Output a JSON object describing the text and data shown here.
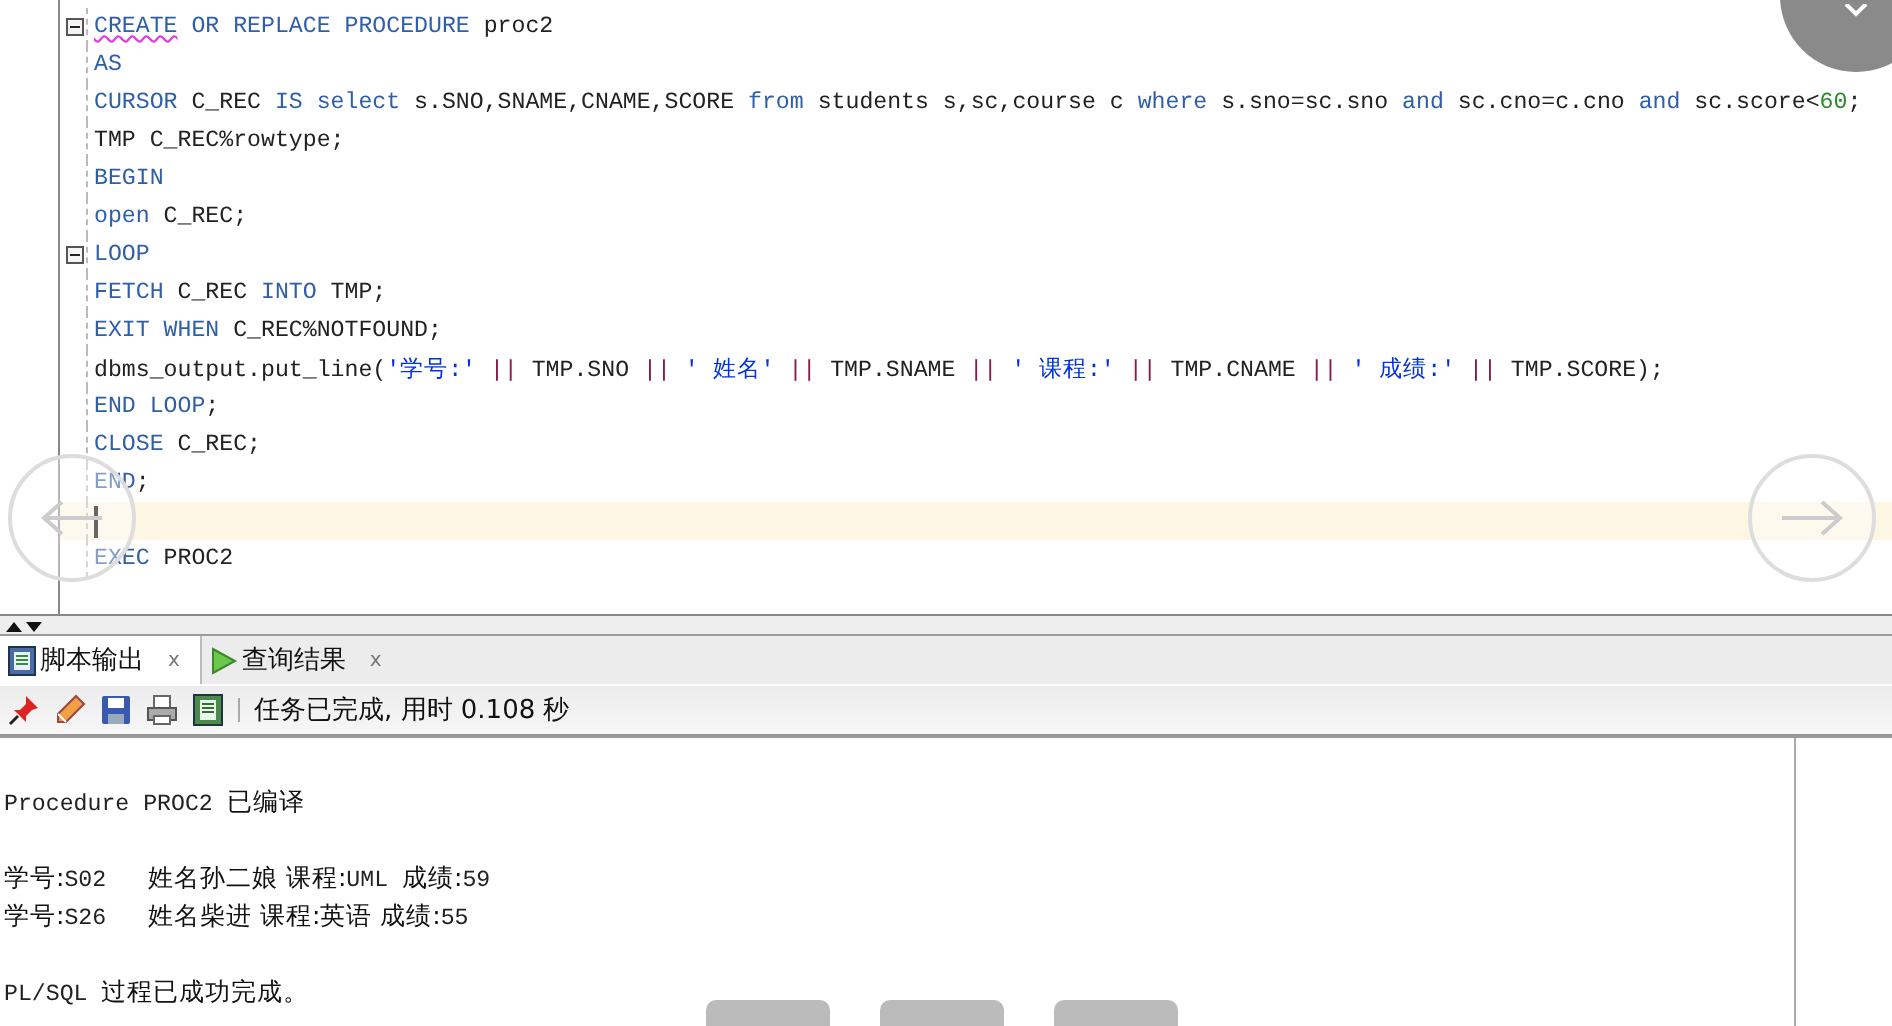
{
  "editor": {
    "lines": [
      {
        "fold": true,
        "current": false,
        "tokens": [
          {
            "kind": "kw",
            "text": "CREATE",
            "squiggle": true
          },
          {
            "kind": "kw",
            "text": " OR REPLACE PROCEDURE"
          },
          {
            "kind": "id",
            "text": " proc2"
          }
        ]
      },
      {
        "fold": false,
        "current": false,
        "tokens": [
          {
            "kind": "kw",
            "text": "AS"
          }
        ]
      },
      {
        "fold": false,
        "current": false,
        "tokens": [
          {
            "kind": "kw",
            "text": "CURSOR"
          },
          {
            "kind": "id",
            "text": " C_REC "
          },
          {
            "kind": "kw",
            "text": "IS select"
          },
          {
            "kind": "id",
            "text": " s.SNO,SNAME,CNAME,SCORE "
          },
          {
            "kind": "kw",
            "text": "from"
          },
          {
            "kind": "id",
            "text": " students s,sc,course c "
          },
          {
            "kind": "kw",
            "text": "where"
          },
          {
            "kind": "id",
            "text": " s.sno=sc.sno "
          },
          {
            "kind": "kw",
            "text": "and"
          },
          {
            "kind": "id",
            "text": " sc.cno=c.cno "
          },
          {
            "kind": "kw",
            "text": "and"
          },
          {
            "kind": "id",
            "text": " sc.score<"
          },
          {
            "kind": "num",
            "text": "60"
          },
          {
            "kind": "id",
            "text": ";"
          }
        ]
      },
      {
        "fold": false,
        "current": false,
        "tokens": [
          {
            "kind": "id",
            "text": "TMP C_REC%rowtype;"
          }
        ]
      },
      {
        "fold": false,
        "current": false,
        "tokens": [
          {
            "kind": "kw",
            "text": "BEGIN"
          }
        ]
      },
      {
        "fold": false,
        "current": false,
        "tokens": [
          {
            "kind": "kw",
            "text": "open"
          },
          {
            "kind": "id",
            "text": " C_REC;"
          }
        ]
      },
      {
        "fold": true,
        "current": false,
        "tokens": [
          {
            "kind": "kw",
            "text": "LOOP"
          }
        ]
      },
      {
        "fold": false,
        "current": false,
        "tokens": [
          {
            "kind": "kw",
            "text": "FETCH"
          },
          {
            "kind": "id",
            "text": " C_REC "
          },
          {
            "kind": "kw",
            "text": "INTO"
          },
          {
            "kind": "id",
            "text": " TMP;"
          }
        ]
      },
      {
        "fold": false,
        "current": false,
        "tokens": [
          {
            "kind": "kw",
            "text": "EXIT WHEN"
          },
          {
            "kind": "id",
            "text": " C_REC%NOTFOUND;"
          }
        ]
      },
      {
        "fold": false,
        "current": false,
        "tokens": [
          {
            "kind": "id",
            "text": "dbms_output.put_line("
          },
          {
            "kind": "str",
            "text": "'学号:'"
          },
          {
            "kind": "op",
            "text": " || "
          },
          {
            "kind": "id",
            "text": "TMP.SNO"
          },
          {
            "kind": "op",
            "text": " || "
          },
          {
            "kind": "str",
            "text": "' 姓名'"
          },
          {
            "kind": "op",
            "text": " || "
          },
          {
            "kind": "id",
            "text": "TMP.SNAME"
          },
          {
            "kind": "op",
            "text": " || "
          },
          {
            "kind": "str",
            "text": "' 课程:'"
          },
          {
            "kind": "op",
            "text": " || "
          },
          {
            "kind": "id",
            "text": "TMP.CNAME"
          },
          {
            "kind": "op",
            "text": " || "
          },
          {
            "kind": "str",
            "text": "' 成绩:'"
          },
          {
            "kind": "op",
            "text": " || "
          },
          {
            "kind": "id",
            "text": "TMP.SCORE);"
          }
        ]
      },
      {
        "fold": false,
        "current": false,
        "tokens": [
          {
            "kind": "kw",
            "text": "END LOOP"
          },
          {
            "kind": "id",
            "text": ";"
          }
        ]
      },
      {
        "fold": false,
        "current": false,
        "tokens": [
          {
            "kind": "kw",
            "text": "CLOSE"
          },
          {
            "kind": "id",
            "text": " C_REC;"
          }
        ]
      },
      {
        "fold": false,
        "current": false,
        "tokens": [
          {
            "kind": "kw",
            "text": "END"
          },
          {
            "kind": "id",
            "text": ";"
          }
        ]
      },
      {
        "fold": false,
        "current": true
      },
      {
        "fold": false,
        "current": false,
        "tokens": [
          {
            "kind": "kw",
            "text": "EXEC"
          },
          {
            "kind": "id",
            "text": " PROC2"
          }
        ]
      }
    ]
  },
  "tabs": [
    {
      "label": "脚本输出",
      "selected": true,
      "close": "x"
    },
    {
      "label": "查询结果",
      "selected": false,
      "close": "x"
    }
  ],
  "toolbar": {
    "status": "任务已完成, 用时 0.108 秒"
  },
  "output": {
    "lines": [
      {
        "tokens": [
          {
            "kind": "id",
            "text": "Procedure PROC2 "
          },
          {
            "kind": "zh",
            "text": "已编译"
          }
        ]
      },
      {
        "kind": "blank"
      },
      {
        "tokens": [
          {
            "kind": "zh",
            "text": "学号:"
          },
          {
            "kind": "id",
            "text": "S02   "
          },
          {
            "kind": "zh",
            "text": "姓名孙二娘 课程:"
          },
          {
            "kind": "id",
            "text": "UML "
          },
          {
            "kind": "zh",
            "text": "成绩:"
          },
          {
            "kind": "id",
            "text": "59"
          }
        ]
      },
      {
        "tokens": [
          {
            "kind": "zh",
            "text": "学号:"
          },
          {
            "kind": "id",
            "text": "S26   "
          },
          {
            "kind": "zh",
            "text": "姓名柴进 课程:英语 成绩:"
          },
          {
            "kind": "id",
            "text": "55"
          }
        ]
      },
      {
        "kind": "blank"
      },
      {
        "tokens": [
          {
            "kind": "id",
            "text": "PL/SQL "
          },
          {
            "kind": "zh",
            "text": "过程已成功完成。"
          }
        ]
      }
    ]
  }
}
